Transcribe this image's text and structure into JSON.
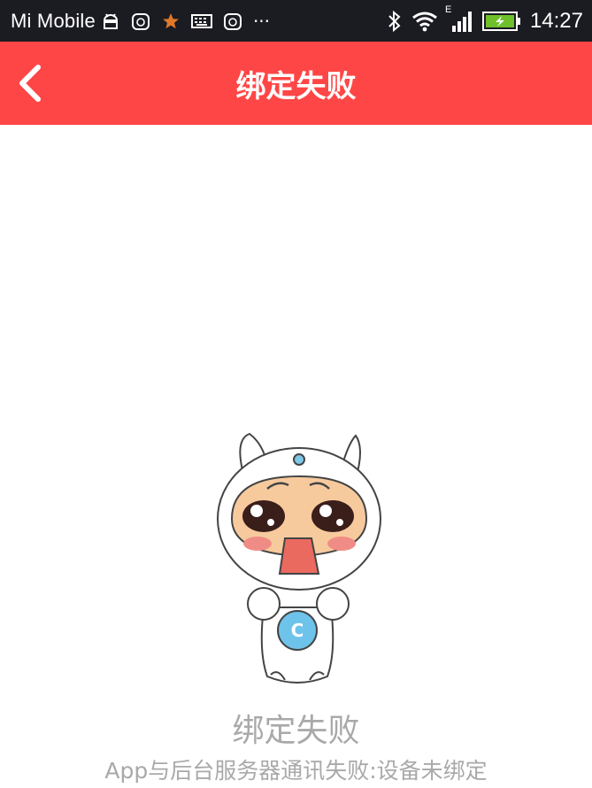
{
  "status_bar": {
    "carrier": "Mi Mobile",
    "network_type": "E",
    "time": "14:27",
    "icons_left": [
      "android-debug-icon",
      "huawei-notification-icon",
      "star-icon",
      "keyboard-icon",
      "huawei-notification-icon",
      "more-icon"
    ],
    "icons_right": [
      "bluetooth-icon",
      "wifi-icon",
      "signal-icon",
      "battery-charging-icon"
    ],
    "more_glyph": "···"
  },
  "app_bar": {
    "title": "绑定失败",
    "back_icon": "chevron-left-icon",
    "color": "#ff4646"
  },
  "main": {
    "illustration": "sad-mascot-illustration",
    "mascot_badge": "C",
    "status_title": "绑定失败",
    "status_detail": "App与后台服务器通讯失败:设备未绑定"
  }
}
